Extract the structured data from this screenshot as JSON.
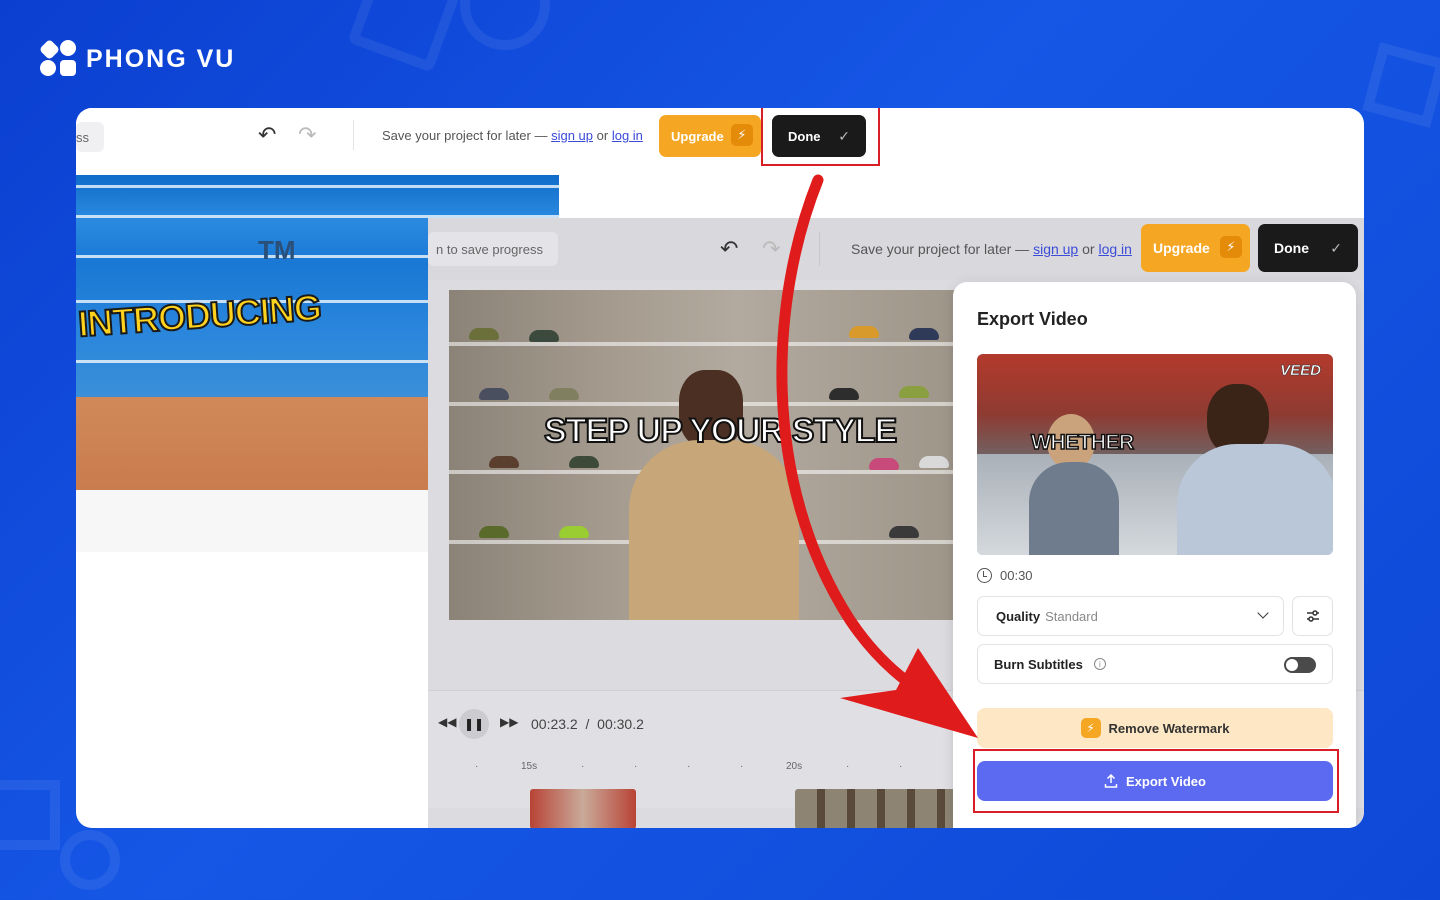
{
  "brand": {
    "name": "PHONG VU"
  },
  "back_editor": {
    "save_prompt_pill": "ss",
    "save_text": "Save your project for later —",
    "sign_up": "sign up",
    "or": "or",
    "log_in": "log in",
    "upgrade_label": "Upgrade",
    "done_label": "Done",
    "video_tm": "TM",
    "video_caption": "INTRODUCING"
  },
  "front_editor": {
    "save_prompt_pill": "n to save progress",
    "save_text": "Save your project for later —",
    "sign_up": "sign up",
    "or": "or",
    "log_in": "log in",
    "upgrade_label": "Upgrade",
    "done_label": "Done",
    "video_caption": "STEP UP YOUR STYLE",
    "current_time": "00:23.2",
    "time_separator": "/",
    "total_time": "00:30.2",
    "ruler_labels": [
      "15s",
      "20s"
    ]
  },
  "export_panel": {
    "title": "Export Video",
    "thumb_logo": "VEED",
    "thumb_caption": "WHETHER",
    "duration": "00:30",
    "quality_label": "Quality",
    "quality_value": "Standard",
    "burn_subtitles_label": "Burn Subtitles",
    "burn_subtitles_on": false,
    "remove_watermark_label": "Remove Watermark",
    "export_button_label": "Export Video"
  },
  "colors": {
    "background": "#1657e6",
    "upgrade": "#f5a623",
    "done": "#1a1a1a",
    "export": "#5c6af2",
    "highlight": "#d81f26",
    "watermark_bg": "#fde7c4"
  }
}
